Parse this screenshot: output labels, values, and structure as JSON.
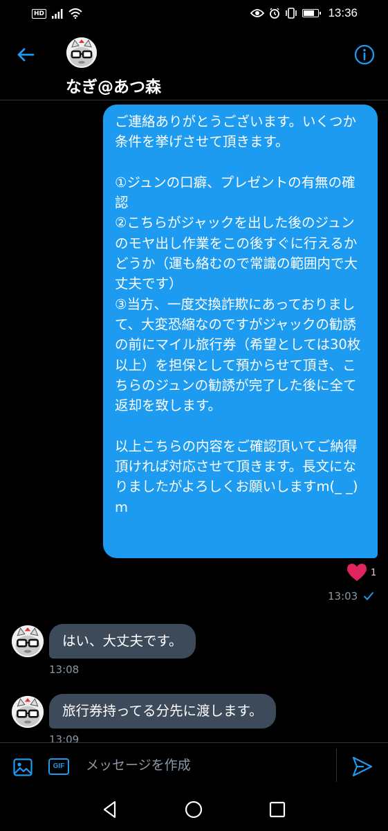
{
  "status_bar": {
    "network_badge": "HD",
    "time": "13:36",
    "battery_level": 0.75
  },
  "header": {
    "contact_name": "なぎ@あつ森"
  },
  "messages": {
    "sent": {
      "text": "ご連絡ありがとうございます。いくつか条件を挙げさせて頂きます。\n\n①ジュンの口癖、プレゼントの有無の確認\n②こちらがジャックを出した後のジュンのモヤ出し作業をこの後すぐに行えるかどうか（運も絡むので常識の範囲内で大丈夫です）\n③当方、一度交換詐欺にあっておりまして、大変恐縮なのですがジャックの勧誘の前にマイル旅行券（希望としては30枚以上）を担保として預からせて頂き、こちらのジュンの勧誘が完了した後に全て返却を致します。\n\n以上こちらの内容をご確認頂いてご納得頂ければ対応させて頂きます。長文になりましたがよろしくお願いしますm(_ _)m",
      "like_count": "1",
      "time": "13:03"
    },
    "received": [
      {
        "text": "はい、大丈夫です。",
        "time": "13:08"
      },
      {
        "text": "旅行券持ってる分先に渡します。",
        "time": "13:09"
      }
    ]
  },
  "composer": {
    "placeholder": "メッセージを作成",
    "gif_label": "GIF"
  },
  "colors": {
    "accent": "#1d9bf0",
    "received_bubble": "#3d4a59",
    "like": "#e0245e",
    "background": "#000000"
  },
  "icons": [
    "back-arrow-icon",
    "info-icon",
    "heart-icon",
    "read-check-icon",
    "image-icon",
    "send-icon",
    "nav-back-icon",
    "nav-home-icon",
    "nav-recents-icon"
  ]
}
